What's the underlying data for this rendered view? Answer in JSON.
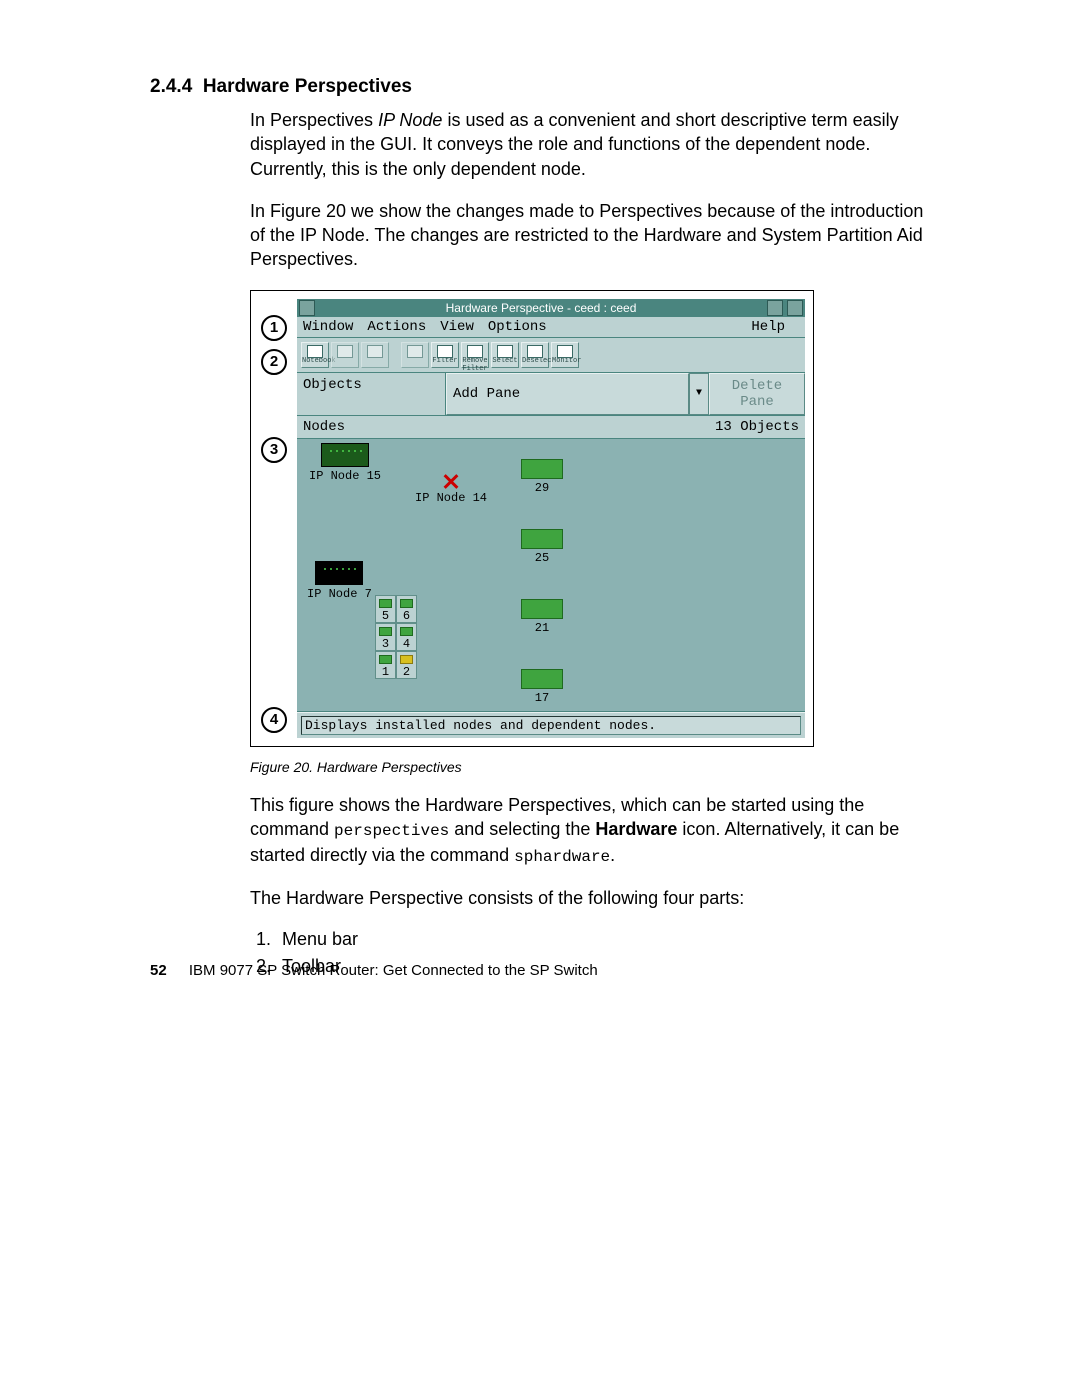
{
  "section": {
    "number": "2.4.4",
    "title": "Hardware Perspectives"
  },
  "para1_prefix": "In Perspectives ",
  "para1_em": "IP Node",
  "para1_suffix": " is used as a convenient and short descriptive term easily displayed in the GUI. It conveys the role and functions of the dependent node. Currently, this is the only dependent node.",
  "para2": "In Figure 20 we show the changes made to Perspectives because of the introduction of the IP Node. The changes are restricted to the Hardware and System Partition Aid Perspectives.",
  "callouts": {
    "c1": "1",
    "c2": "2",
    "c3": "3",
    "c4": "4"
  },
  "gui": {
    "title": "Hardware Perspective - ceed : ceed",
    "menubar": [
      "Window",
      "Actions",
      "View",
      "Options"
    ],
    "help": "Help",
    "toolbar": {
      "btn1": "Notebook",
      "btn4": "Filter",
      "btn5": "Remove Filter",
      "btn6": "Select",
      "btn7": "Deselect",
      "btn8": "Monitor"
    },
    "objrow": {
      "objects": "Objects",
      "add": "Add Pane",
      "del": "Delete Pane"
    },
    "nodesHeader": {
      "left": "Nodes",
      "right": "13 Objects"
    },
    "nodes": {
      "ip15": "IP Node 15",
      "ip14": "IP Node 14",
      "ip7": "IP Node 7",
      "s5": "5",
      "s6": "6",
      "s3": "3",
      "s4": "4",
      "s1": "1",
      "s2": "2",
      "r29": "29",
      "r25": "25",
      "r21": "21",
      "r17": "17"
    },
    "status": "Displays installed nodes and dependent nodes."
  },
  "figcaption": "Figure 20.  Hardware Perspectives",
  "para3_a": "This figure shows the Hardware Perspectives, which can be started using the command ",
  "para3_code1": "perspectives",
  "para3_b": " and selecting the ",
  "para3_bold": "Hardware",
  "para3_c": " icon. Alternatively, it can be started directly via the command ",
  "para3_code2": "sphardware",
  "para3_d": ".",
  "para4": "The Hardware Perspective consists of the following four parts:",
  "listItems": [
    "Menu bar",
    "Toolbar"
  ],
  "footer": {
    "page": "52",
    "text": "IBM 9077 SP Switch Router: Get Connected to the SP Switch"
  }
}
